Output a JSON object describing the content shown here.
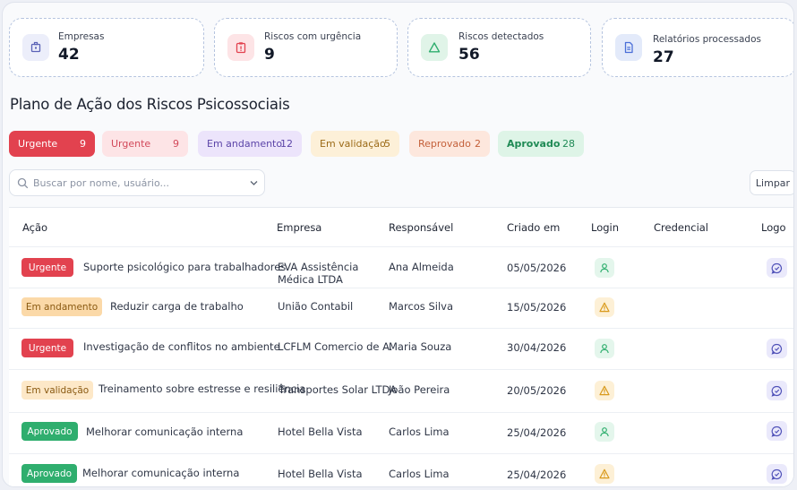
{
  "stats": [
    {
      "label": "Empresas",
      "value": "42",
      "icon": "building-icon",
      "color": "#5b63b7"
    },
    {
      "label": "Riscos com urgência",
      "value": "9",
      "icon": "clipboard-alert-icon",
      "color": "#e2424f"
    },
    {
      "label": "Riscos detectados",
      "value": "56",
      "icon": "triangle-icon",
      "color": "#2fae6e"
    },
    {
      "label": "Relatórios processados",
      "value": "27",
      "icon": "document-icon",
      "color": "#4a6fd8"
    }
  ],
  "page_title": "Plano de Ação dos Riscos Psicossociais",
  "filters": [
    {
      "label": "Urgente",
      "count": "9",
      "bg": "#e2424f",
      "fg": "#ffffff"
    },
    {
      "label": "Urgente",
      "count": "9",
      "bg": "#fde4e6",
      "fg": "#d2495a"
    },
    {
      "label": "Em andamento",
      "count": "12",
      "bg": "#ece4fb",
      "fg": "#5b44a8"
    },
    {
      "label": "Em validação",
      "count": "5",
      "bg": "#fdf0d8",
      "fg": "#9b6a17"
    },
    {
      "label": "Reprovado",
      "count": "2",
      "bg": "#fde7dd",
      "fg": "#c4603a"
    },
    {
      "label": "Aprovado",
      "count": "28",
      "bg": "#def4e7",
      "fg": "#1f8a55"
    }
  ],
  "search": {
    "placeholder": "Buscar por nome, usuário..."
  },
  "clear_label": "Limpar",
  "table": {
    "headers": {
      "acao": "Ação",
      "empresa": "Empresa",
      "responsavel": "Responsável",
      "criado": "Criado em",
      "login": "Login",
      "credencial": "Credencial",
      "logo": "Logo"
    },
    "rows": [
      {
        "status": "Urgente",
        "status_class": "b-urgente",
        "acao": "Suporte psicológico para trabalhadores",
        "empresa": "EVA Assistência",
        "empresa2": "Médica LTDA",
        "responsavel": "Ana Almeida",
        "criado": "05/05/2026",
        "login": "ok"
      },
      {
        "status": "Em andamento",
        "status_class": "b-andamento",
        "acao": "Reduzir carga de trabalho",
        "empresa": "União Contabil",
        "empresa2": "",
        "responsavel": "Marcos Silva",
        "criado": "15/05/2026",
        "login": "warn"
      },
      {
        "status": "Urgente",
        "status_class": "b-urgente",
        "acao": "Investigação de conflitos no ambiente",
        "empresa": "LCFLM Comercio de A.",
        "empresa2": "",
        "responsavel": "Maria Souza",
        "criado": "30/04/2026",
        "login": "ok"
      },
      {
        "status": "Em validação",
        "status_class": "b-validacao",
        "acao": "Treinamento sobre estresse e resiliência",
        "empresa": "Transportes Solar LTDA",
        "empresa2": "",
        "responsavel": "João Pereira",
        "criado": "20/05/2026",
        "login": "warn"
      },
      {
        "status": "Aprovado",
        "status_class": "b-aprovado",
        "acao": "Melhorar comunicação interna",
        "empresa": "Hotel Bella Vista",
        "empresa2": "",
        "responsavel": "Carlos Lima",
        "criado": "25/04/2026",
        "login": "ok"
      },
      {
        "status": "Aprovado",
        "status_class": "b-aprovado",
        "acao": "Melhorar comunicação interna",
        "empresa": "Hotel Bella Vista",
        "empresa2": "",
        "responsavel": "Carlos Lima",
        "criado": "25/04/2026",
        "login": "warn"
      }
    ]
  }
}
